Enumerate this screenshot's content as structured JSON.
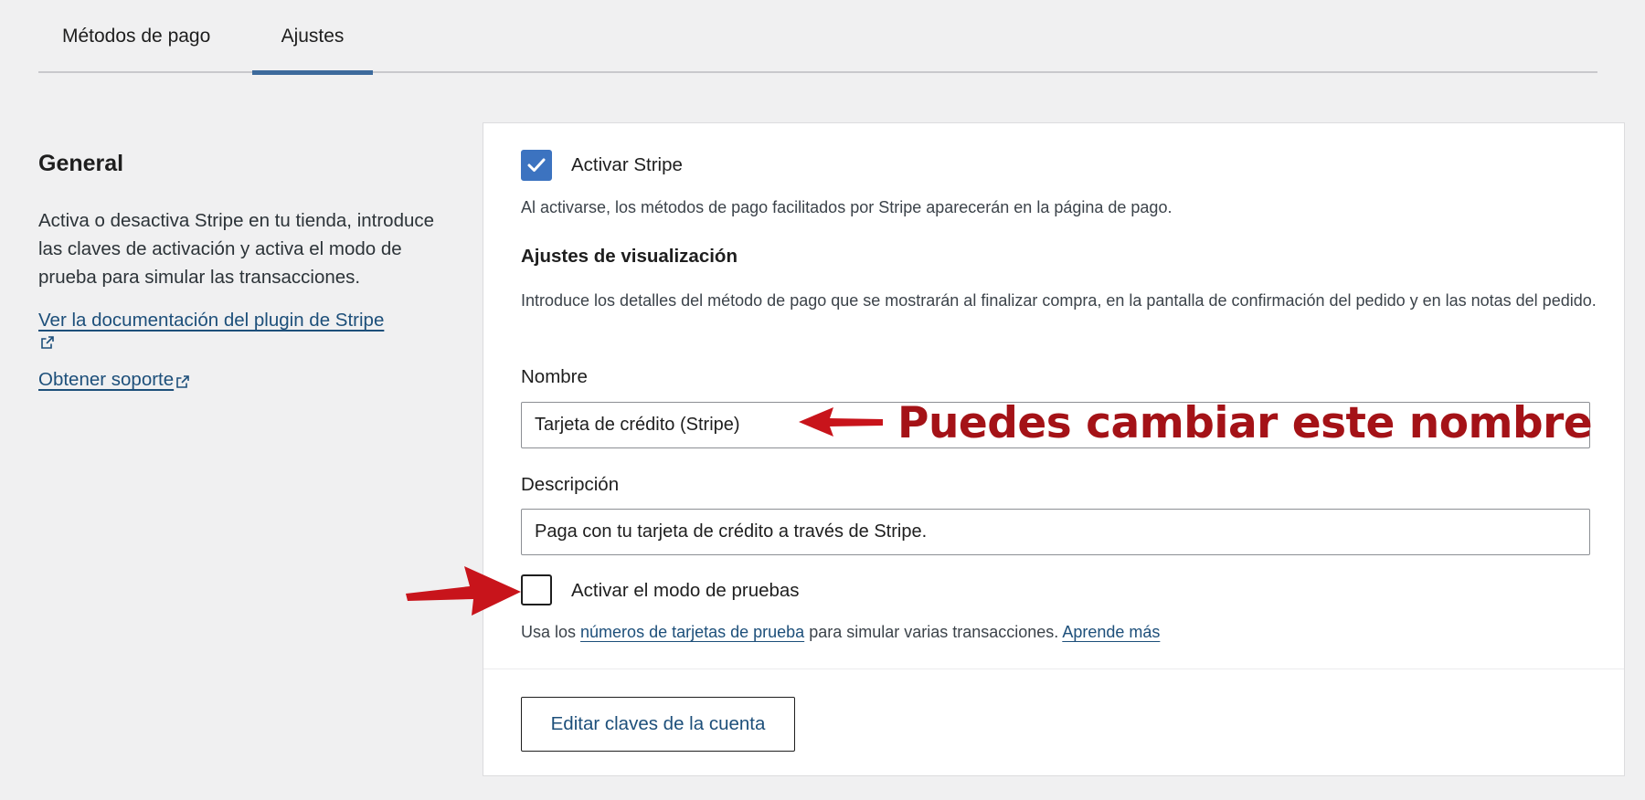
{
  "tabs": {
    "payment_methods": "Métodos de pago",
    "settings": "Ajustes"
  },
  "general": {
    "title": "General",
    "description": "Activa o desactiva Stripe en tu tienda, introduce las claves de activación y activa el modo de prueba para simular las transacciones.",
    "doc_link": "Ver la documentación del plugin de Stripe",
    "support_link": "Obtener soporte"
  },
  "settings": {
    "enable_stripe": {
      "label": "Activar Stripe",
      "checked": true,
      "help": "Al activarse, los métodos de pago facilitados por Stripe aparecerán en la página de pago."
    },
    "display_section": {
      "title": "Ajustes de visualización",
      "description": "Introduce los detalles del método de pago que se mostrarán al finalizar compra, en la pantalla de confirmación del pedido y en las notas del pedido."
    },
    "name": {
      "label": "Nombre",
      "value": "Tarjeta de crédito (Stripe)"
    },
    "description_field": {
      "label": "Descripción",
      "value": "Paga con tu tarjeta de crédito a través de Stripe."
    },
    "test_mode": {
      "label": "Activar el modo de pruebas",
      "checked": false,
      "help_prefix": "Usa los ",
      "help_link": "números de tarjetas de prueba",
      "help_middle": " para simular varias transacciones. ",
      "learn_more": "Aprende más"
    },
    "edit_keys_button": "Editar claves de la cuenta"
  },
  "annotation": {
    "text": "Puedes cambiar este nombre",
    "color": "#a41217"
  },
  "colors": {
    "accent": "#3c73c0",
    "link": "#1d4f7a",
    "tab_indicator": "#3d6a9c"
  }
}
